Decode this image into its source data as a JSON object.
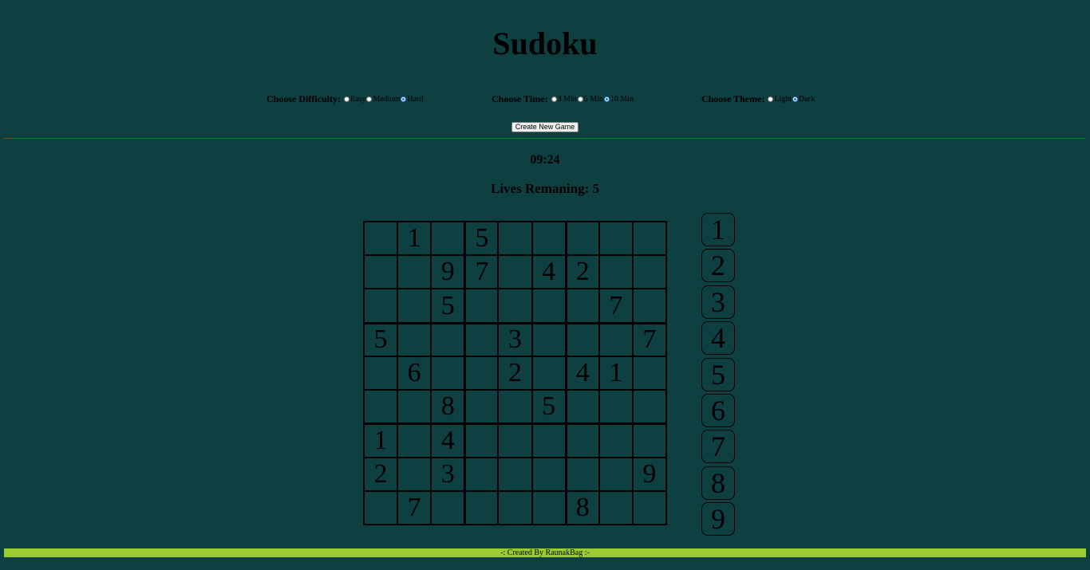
{
  "title": "Sudoku",
  "options": {
    "difficulty": {
      "label": "Choose Difficulty:",
      "choices": [
        "Easy",
        "Medium",
        "Hard"
      ],
      "selected": "Hard"
    },
    "time": {
      "label": "Choose Time:",
      "choices": [
        "3 Min",
        "5 Min",
        "10 Min"
      ],
      "selected": "10 Min"
    },
    "theme": {
      "label": "Choose Theme:",
      "choices": [
        "Light",
        "Dark"
      ],
      "selected": "Dark"
    }
  },
  "create_button_label": "Create New Game",
  "timer": "09:24",
  "lives_text": "Lives Remaning: 5",
  "board": [
    [
      "",
      "1",
      "",
      "5",
      "",
      "",
      "",
      "",
      ""
    ],
    [
      "",
      "",
      "9",
      "7",
      "",
      "4",
      "2",
      "",
      ""
    ],
    [
      "",
      "",
      "5",
      "",
      "",
      "",
      "",
      "7",
      ""
    ],
    [
      "5",
      "",
      "",
      "",
      "3",
      "",
      "",
      "",
      "7"
    ],
    [
      "",
      "6",
      "",
      "",
      "2",
      "",
      "4",
      "1",
      ""
    ],
    [
      "",
      "",
      "8",
      "",
      "",
      "5",
      "",
      "",
      ""
    ],
    [
      "1",
      "",
      "4",
      "",
      "",
      "",
      "",
      "",
      ""
    ],
    [
      "2",
      "",
      "3",
      "",
      "",
      "",
      "",
      "",
      "9"
    ],
    [
      "",
      "7",
      "",
      "",
      "",
      "",
      "8",
      "",
      ""
    ]
  ],
  "number_pad": [
    "1",
    "2",
    "3",
    "4",
    "5",
    "6",
    "7",
    "8",
    "9"
  ],
  "footer": "-: Created By RaunakBag :-",
  "colors": {
    "background": "#0e4042",
    "footer": "#9acd32",
    "divider": "#7a4a1c",
    "radio_checked": "#1a73e8"
  }
}
